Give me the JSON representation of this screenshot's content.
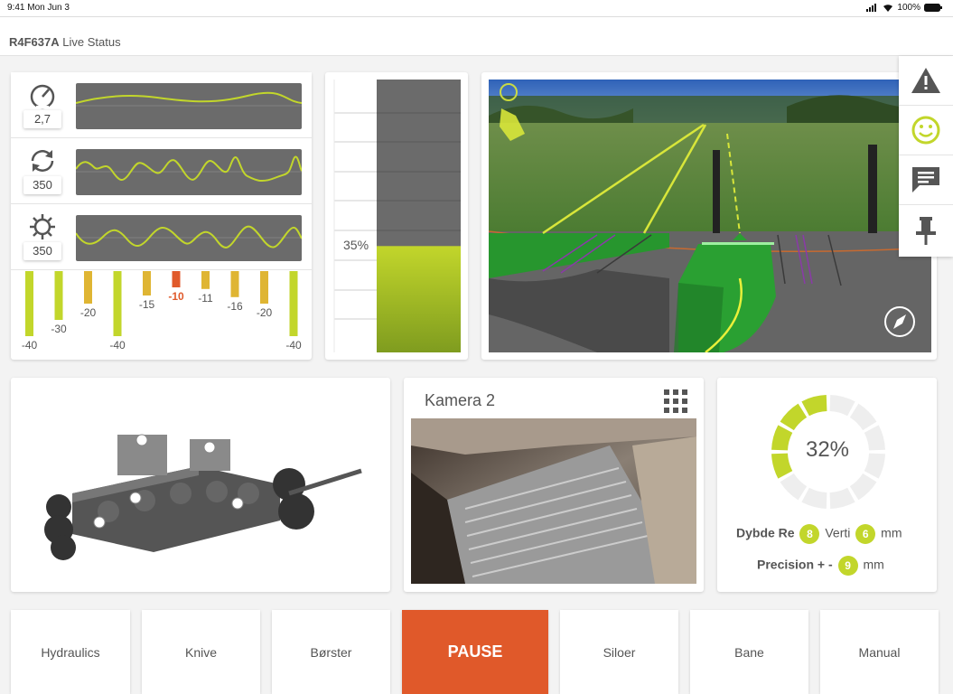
{
  "status_bar": {
    "time": "9:41 Mon Jun 3",
    "battery": "100%"
  },
  "header": {
    "machine_id": "R4F637A",
    "title": "Live Status"
  },
  "sensors": [
    {
      "icon": "speedometer-icon",
      "value": "2,7"
    },
    {
      "icon": "rotation-icon",
      "value": "350"
    },
    {
      "icon": "gear-icon",
      "value": "350"
    }
  ],
  "bar_values": [
    "-40",
    "-30",
    "-20",
    "-40",
    "-15",
    "-10",
    "-11",
    "-16",
    "-20",
    "-40"
  ],
  "bar_colors": {
    "high": "#c2d62b",
    "mid": "#dfb533",
    "hot": "#e05a2b"
  },
  "level": {
    "label": "35%",
    "value": 0.35
  },
  "field_tools": [
    "warning-icon",
    "smiley-icon",
    "chat-icon",
    "pin-icon"
  ],
  "camera": {
    "title": "Kamera 2"
  },
  "depth": {
    "percent": "32%",
    "value": 0.32,
    "line1_label": "Dybde Re",
    "re_value": "8",
    "verti_label": "Verti",
    "verti_value": "6",
    "unit": "mm",
    "line2_label": "Precision + -",
    "precision_value": "9",
    "unit2": "mm"
  },
  "tabs": [
    "Hydraulics",
    "Knive",
    "Børster",
    "PAUSE",
    "Siloer",
    "Bane",
    "Manual"
  ],
  "colors": {
    "accent": "#c2d62b",
    "pause": "#e0592a"
  }
}
